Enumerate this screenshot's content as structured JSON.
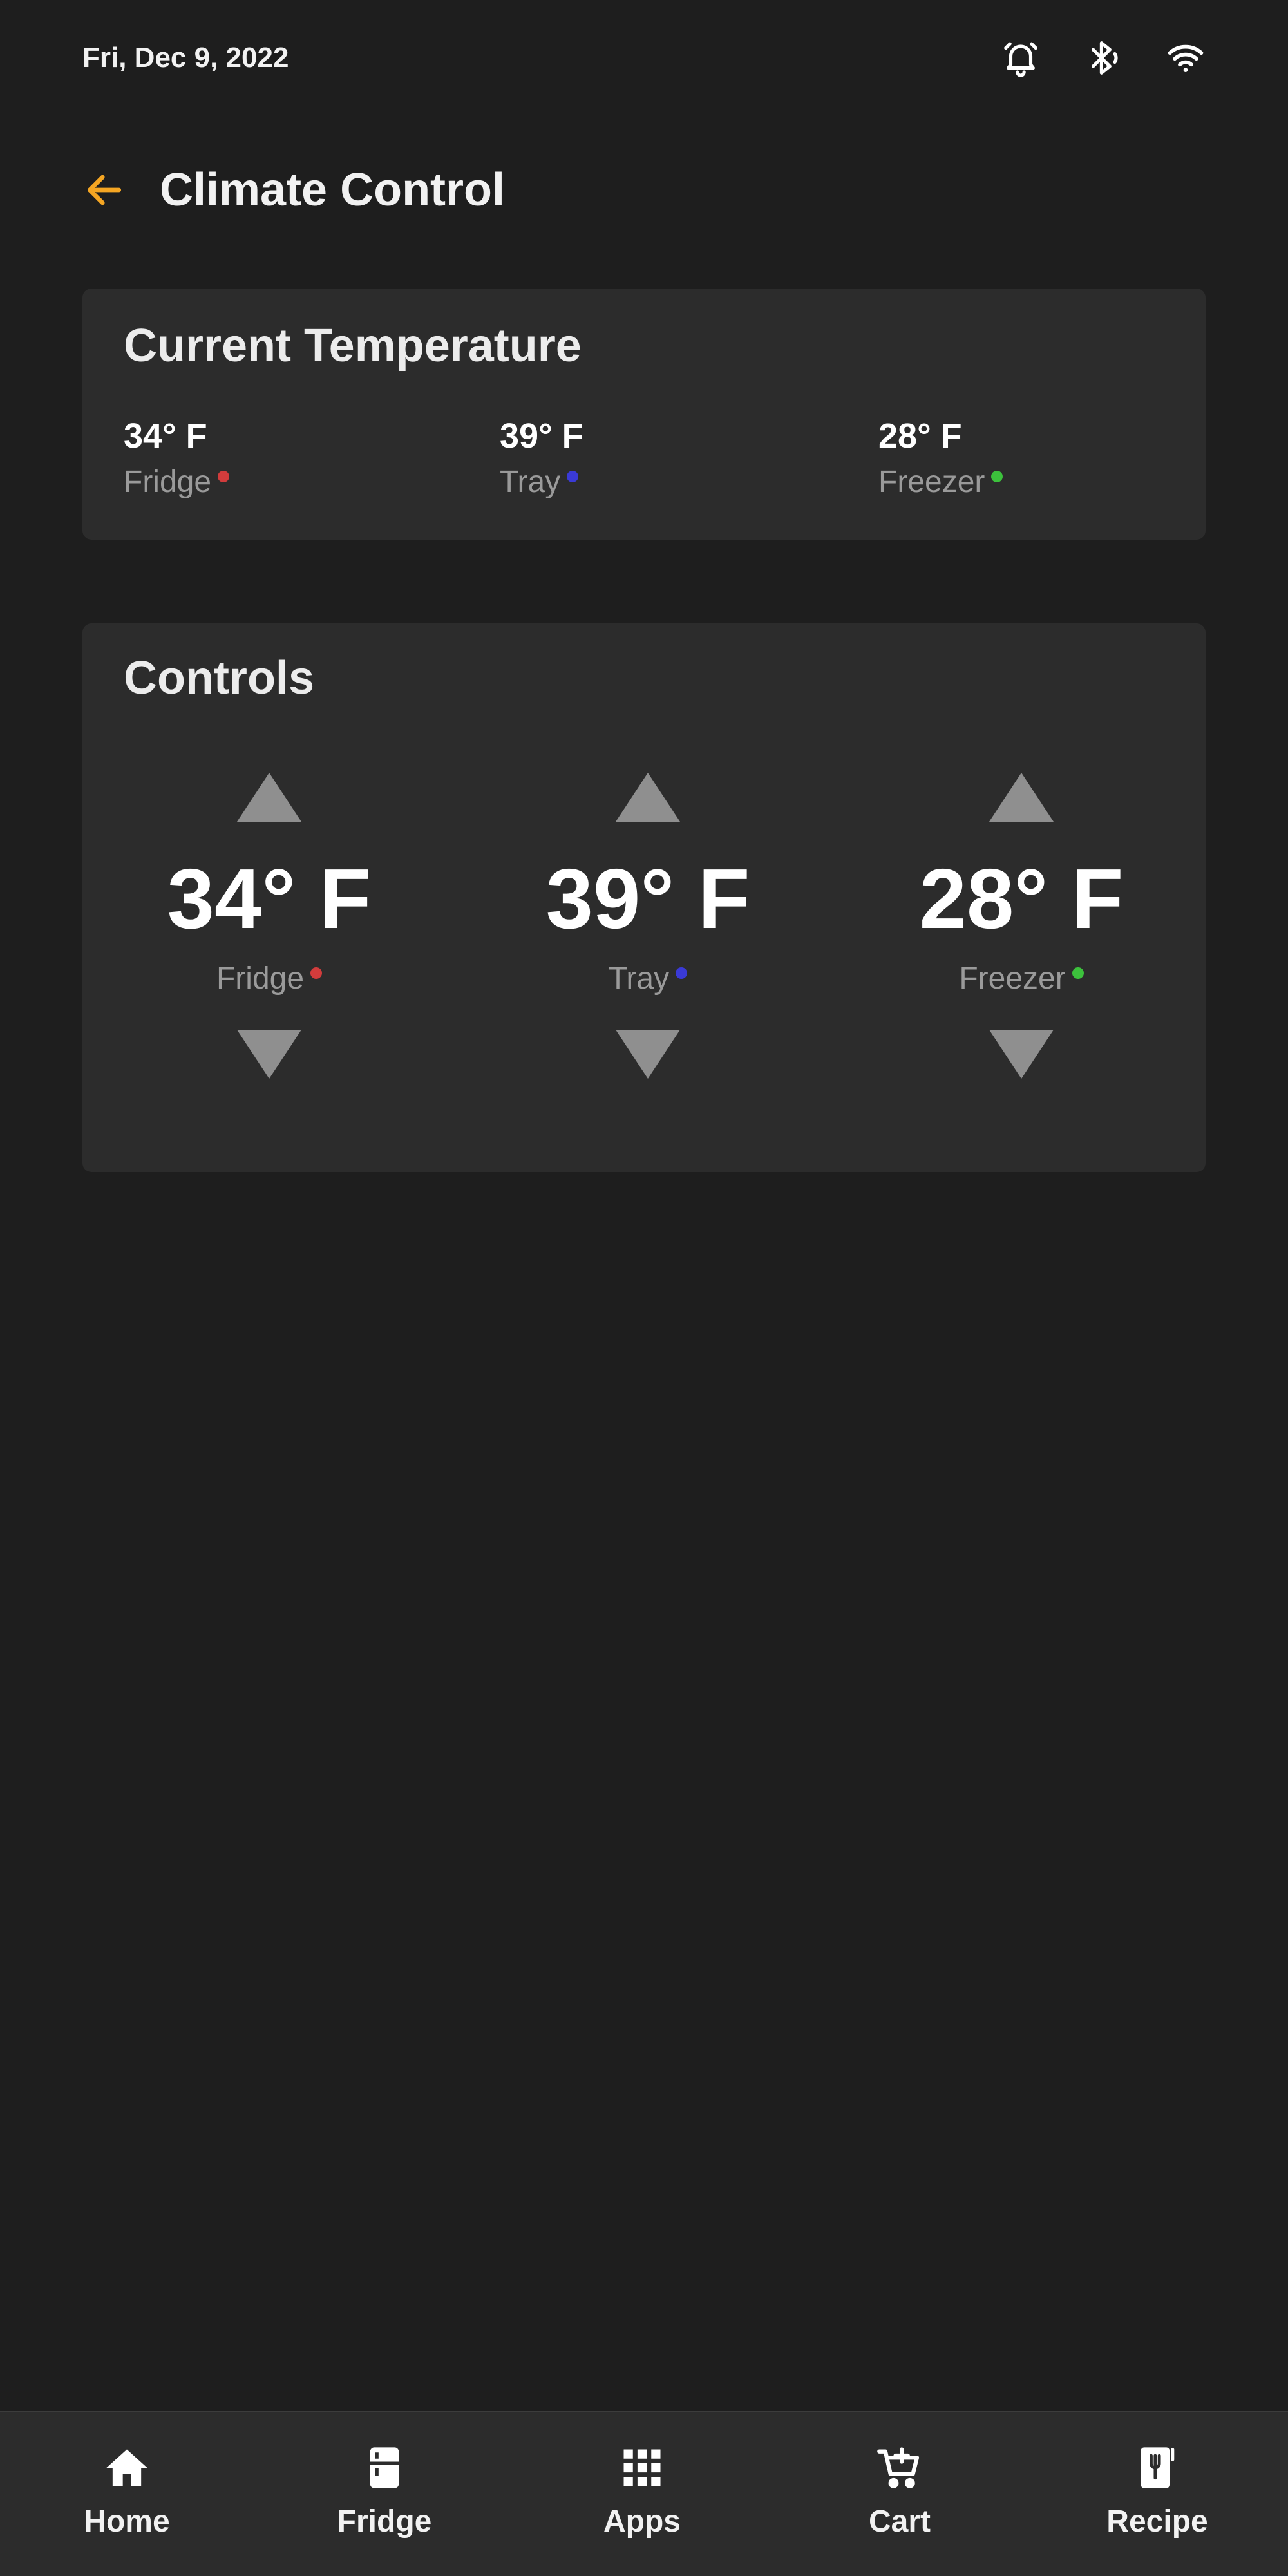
{
  "status_bar": {
    "date": "Fri, Dec 9, 2022",
    "icons": [
      "alarm-icon",
      "bluetooth-icon",
      "wifi-icon"
    ]
  },
  "header": {
    "back_icon": "arrow-left-icon",
    "title": "Climate Control"
  },
  "current_temperature": {
    "title": "Current Temperature",
    "readings": [
      {
        "value": "34° F",
        "label": "Fridge",
        "color": "#d23c3c"
      },
      {
        "value": "39° F",
        "label": "Tray",
        "color": "#3a3ad6"
      },
      {
        "value": "28° F",
        "label": "Freezer",
        "color": "#3cc13c"
      }
    ]
  },
  "controls": {
    "title": "Controls",
    "items": [
      {
        "value": "34° F",
        "label": "Fridge",
        "color": "#d23c3c"
      },
      {
        "value": "39° F",
        "label": "Tray",
        "color": "#3a3ad6"
      },
      {
        "value": "28° F",
        "label": "Freezer",
        "color": "#3cc13c"
      }
    ]
  },
  "bottom_nav": {
    "items": [
      {
        "label": "Home",
        "icon": "home-icon"
      },
      {
        "label": "Fridge",
        "icon": "fridge-icon"
      },
      {
        "label": "Apps",
        "icon": "apps-grid-icon"
      },
      {
        "label": "Cart",
        "icon": "cart-add-icon"
      },
      {
        "label": "Recipe",
        "icon": "recipe-book-icon"
      }
    ]
  },
  "colors": {
    "accent": "#f5a623",
    "background": "#1e1e1e",
    "card": "#2c2c2c",
    "arrow": "#8f8f8f"
  }
}
